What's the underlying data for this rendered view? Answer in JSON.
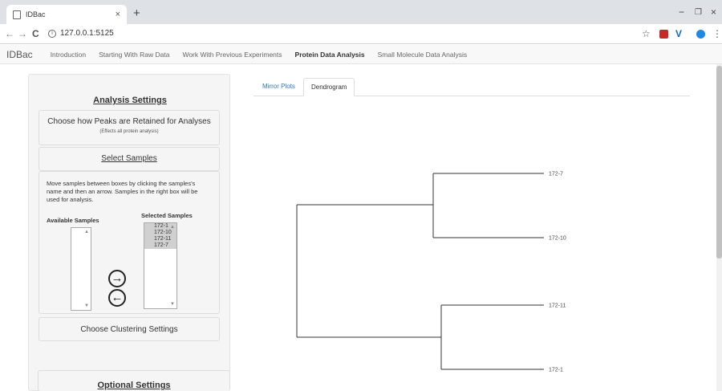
{
  "browser": {
    "tab_title": "IDBac",
    "tab_close": "×",
    "new_tab": "+",
    "url": "127.0.0.1:5125",
    "back": "←",
    "forward": "→",
    "reload": "C",
    "star": "☆",
    "menu": "⋮",
    "minimize": "−",
    "maximize": "❐",
    "close": "×"
  },
  "app": {
    "brand": "IDBac",
    "nav": [
      "Introduction",
      "Starting With Raw Data",
      "Work With Previous Experiments",
      "Protein Data Analysis",
      "Small Molecule Data Analysis"
    ],
    "active_nav": "Protein Data Analysis"
  },
  "sidebar": {
    "title": "Analysis Settings",
    "peaks_heading": "Choose how Peaks are Retained for Analyses",
    "peaks_sub": "(Effects all protein analysis)",
    "select_samples": "Select Samples",
    "instructions": "Move samples between boxes by clicking the samples's name and then an arrow. Samples in the right box will be used for analysis.",
    "available_label": "Available Samples",
    "selected_label": "Selected Samples",
    "selected_samples": [
      "172-1",
      "172-10",
      "172-11",
      "172-7"
    ],
    "clustering": "Choose Clustering Settings",
    "optional": "Optional Settings"
  },
  "main": {
    "tabs": [
      "Mirror Plots",
      "Dendrogram"
    ],
    "active_tab": "Dendrogram",
    "dendrogram_leaves": [
      "172-7",
      "172-10",
      "172-11",
      "172-1"
    ]
  },
  "colors": {
    "link": "#337ab7",
    "ext_red": "#c62828",
    "ext_blue": "#1565c0",
    "profile": "#1e88e5"
  }
}
